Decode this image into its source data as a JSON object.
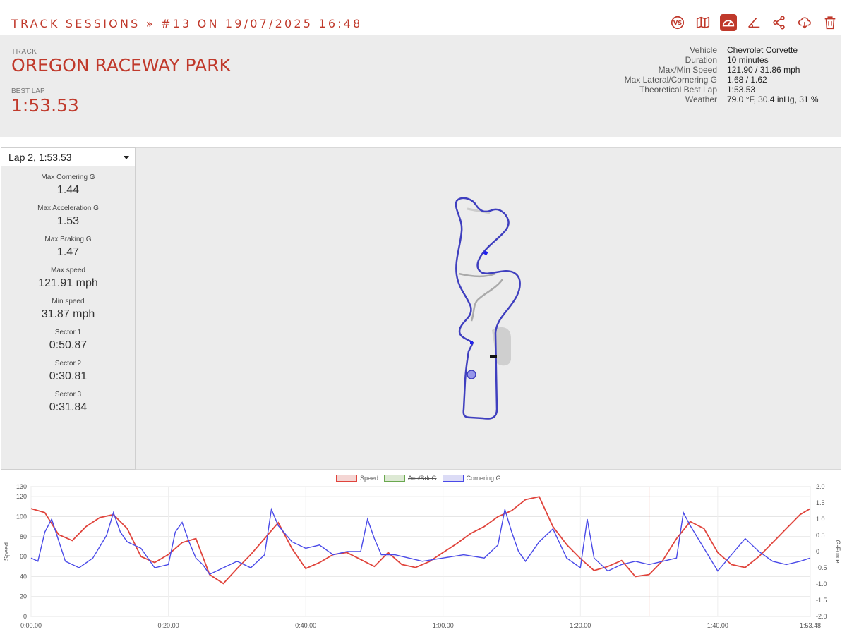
{
  "breadcrumb": "TRACK SESSIONS » #13 ON 19/07/2025 16:48",
  "toolbar": [
    {
      "name": "compare-vs-icon",
      "label": "VS"
    },
    {
      "name": "map-icon"
    },
    {
      "name": "speedometer-icon"
    },
    {
      "name": "angle-icon"
    },
    {
      "name": "share-icon"
    },
    {
      "name": "cloud-download-icon"
    },
    {
      "name": "trash-icon"
    }
  ],
  "colors": {
    "accent": "#c0392b",
    "speed": "#e0443c",
    "acc": "#6aa84f",
    "cornering": "#4a4ae8"
  },
  "header": {
    "track_label": "TRACK",
    "track_name": "OREGON RACEWAY PARK",
    "bestlap_label": "BEST LAP",
    "bestlap": "1:53.53",
    "stats": [
      {
        "k": "Vehicle",
        "v": "Chevrolet Corvette"
      },
      {
        "k": "Duration",
        "v": "10 minutes"
      },
      {
        "k": "Max/Min Speed",
        "v": "121.90 / 31.86 mph"
      },
      {
        "k": "Max Lateral/Cornering G",
        "v": "1.68 / 1.62"
      },
      {
        "k": "Theoretical Best Lap",
        "v": "1:53.53"
      },
      {
        "k": "Weather",
        "v": "79.0 °F, 30.4 inHg, 31 %"
      }
    ]
  },
  "lap_selector": {
    "value": "Lap 2, 1:53.53"
  },
  "metrics": [
    {
      "label": "Max Cornering G",
      "value": "1.44"
    },
    {
      "label": "Max Acceleration G",
      "value": "1.53"
    },
    {
      "label": "Max Braking G",
      "value": "1.47"
    },
    {
      "label": "Max speed",
      "value": "121.91 mph"
    },
    {
      "label": "Min speed",
      "value": "31.87 mph"
    },
    {
      "label": "Sector 1",
      "value": "0:50.87"
    },
    {
      "label": "Sector 2",
      "value": "0:30.81"
    },
    {
      "label": "Sector 3",
      "value": "0:31.84"
    }
  ],
  "chart_data": {
    "type": "line",
    "legend": [
      {
        "name": "Speed",
        "hidden": false
      },
      {
        "name": "Acc/Brk G",
        "hidden": true
      },
      {
        "name": "Cornering G",
        "hidden": false
      }
    ],
    "ylabel": "Speed",
    "y2label": "G-Force",
    "ylim": [
      0,
      130
    ],
    "y2lim": [
      -2.0,
      2.0
    ],
    "yticks": [
      "0",
      "20",
      "40",
      "60",
      "80",
      "100",
      "120",
      "130"
    ],
    "y2ticks": [
      "-2.0",
      "-1.5",
      "-1.0",
      "-0.5",
      "0",
      "0.5",
      "1.0",
      "1.5",
      "2.0"
    ],
    "xticks": [
      "0:00.00",
      "0:20.00",
      "0:40.00",
      "1:00.00",
      "1:20.00",
      "1:40.00",
      "1:53.48"
    ],
    "xlim_seconds": [
      0,
      113.48
    ],
    "cursor_seconds": 90,
    "series": [
      {
        "name": "Speed",
        "x": [
          0,
          2,
          4,
          6,
          8,
          10,
          12,
          14,
          16,
          18,
          20,
          22,
          24,
          26,
          28,
          30,
          32,
          34,
          36,
          38,
          40,
          42,
          44,
          46,
          48,
          50,
          52,
          54,
          56,
          58,
          60,
          62,
          64,
          66,
          68,
          70,
          72,
          74,
          76,
          78,
          80,
          82,
          84,
          86,
          88,
          90,
          92,
          94,
          96,
          98,
          100,
          102,
          104,
          106,
          108,
          110,
          112,
          113.48
        ],
        "values": [
          108,
          104,
          82,
          76,
          90,
          99,
          102,
          88,
          60,
          54,
          62,
          74,
          78,
          42,
          33,
          48,
          62,
          78,
          94,
          68,
          48,
          54,
          62,
          64,
          57,
          50,
          64,
          52,
          49,
          55,
          64,
          73,
          83,
          90,
          100,
          106,
          117,
          120,
          90,
          72,
          58,
          46,
          50,
          56,
          40,
          42,
          56,
          78,
          95,
          88,
          64,
          52,
          49,
          60,
          74,
          88,
          102,
          108
        ]
      },
      {
        "name": "Cornering G",
        "x": [
          0,
          1,
          2,
          3,
          5,
          7,
          9,
          11,
          12,
          13,
          14,
          16,
          18,
          20,
          21,
          22,
          23,
          24,
          25,
          26,
          28,
          30,
          32,
          34,
          35,
          36,
          38,
          40,
          42,
          44,
          46,
          48,
          49,
          50,
          51,
          53,
          55,
          57,
          60,
          63,
          66,
          68,
          69,
          70,
          71,
          72,
          74,
          76,
          78,
          80,
          81,
          82,
          84,
          86,
          88,
          90,
          92,
          94,
          95,
          96,
          98,
          100,
          102,
          104,
          106,
          108,
          110,
          112,
          113.48
        ],
        "values": [
          -0.2,
          -0.3,
          0.6,
          1.0,
          -0.3,
          -0.5,
          -0.2,
          0.5,
          1.2,
          0.6,
          0.3,
          0.1,
          -0.5,
          -0.4,
          0.6,
          0.9,
          0.3,
          -0.2,
          -0.4,
          -0.7,
          -0.5,
          -0.3,
          -0.5,
          -0.1,
          1.3,
          0.8,
          0.3,
          0.1,
          0.2,
          -0.1,
          0.0,
          0.0,
          1.0,
          0.4,
          -0.1,
          -0.1,
          -0.2,
          -0.3,
          -0.2,
          -0.1,
          -0.2,
          0.2,
          1.3,
          0.6,
          0.0,
          -0.3,
          0.3,
          0.7,
          -0.2,
          -0.5,
          1.0,
          -0.2,
          -0.6,
          -0.4,
          -0.3,
          -0.4,
          -0.3,
          -0.2,
          1.2,
          0.8,
          0.1,
          -0.6,
          -0.1,
          0.4,
          0.0,
          -0.3,
          -0.4,
          -0.3,
          -0.2
        ]
      }
    ]
  }
}
